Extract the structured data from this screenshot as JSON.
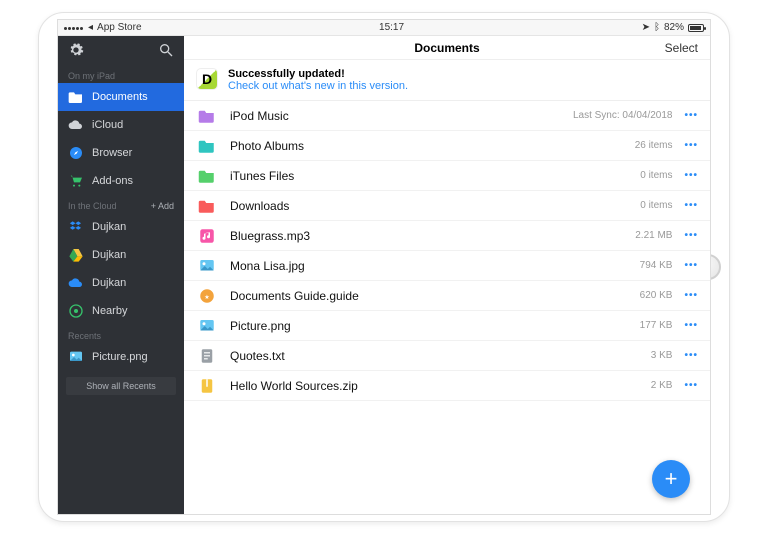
{
  "statusbar": {
    "back_label": "App Store",
    "time": "15:17",
    "battery_pct": "82%"
  },
  "sidebar": {
    "section_on_device": "On my iPad",
    "section_cloud": "In the Cloud",
    "section_recents": "Recents",
    "add_label": "+ Add",
    "show_all": "Show all Recents",
    "items_device": [
      {
        "label": "Documents",
        "icon": "folder",
        "selected": true
      },
      {
        "label": "iCloud",
        "icon": "cloud"
      },
      {
        "label": "Browser",
        "icon": "compass"
      },
      {
        "label": "Add-ons",
        "icon": "cart"
      }
    ],
    "items_cloud": [
      {
        "label": "Dujkan",
        "icon": "dropbox"
      },
      {
        "label": "Dujkan",
        "icon": "gdrive"
      },
      {
        "label": "Dujkan",
        "icon": "onedrive"
      },
      {
        "label": "Nearby",
        "icon": "nearby"
      }
    ],
    "items_recent": [
      {
        "label": "Picture.png",
        "icon": "image"
      }
    ]
  },
  "main": {
    "title": "Documents",
    "select": "Select"
  },
  "banner": {
    "title": "Successfully updated!",
    "link": "Check out what's new in this version."
  },
  "files": [
    {
      "name": "iPod Music",
      "meta": "Last Sync: 04/04/2018",
      "icon": "folder-music",
      "color": "folder-purple"
    },
    {
      "name": "Photo Albums",
      "meta": "26 items",
      "icon": "folder-generic",
      "color": "folder-teal"
    },
    {
      "name": "iTunes Files",
      "meta": "0 items",
      "icon": "folder-music",
      "color": "folder-green"
    },
    {
      "name": "Downloads",
      "meta": "0 items",
      "icon": "folder-download",
      "color": "folder-red"
    },
    {
      "name": "Bluegrass.mp3",
      "meta": "2.21 MB",
      "icon": "audio",
      "color": "audio-pink"
    },
    {
      "name": "Mona Lisa.jpg",
      "meta": "794 KB",
      "icon": "image",
      "color": ""
    },
    {
      "name": "Documents Guide.guide",
      "meta": "620 KB",
      "icon": "guide",
      "color": ""
    },
    {
      "name": "Picture.png",
      "meta": "177 KB",
      "icon": "image",
      "color": ""
    },
    {
      "name": "Quotes.txt",
      "meta": "3 KB",
      "icon": "text",
      "color": ""
    },
    {
      "name": "Hello World Sources.zip",
      "meta": "2 KB",
      "icon": "zip",
      "color": "zip-yellow"
    }
  ]
}
